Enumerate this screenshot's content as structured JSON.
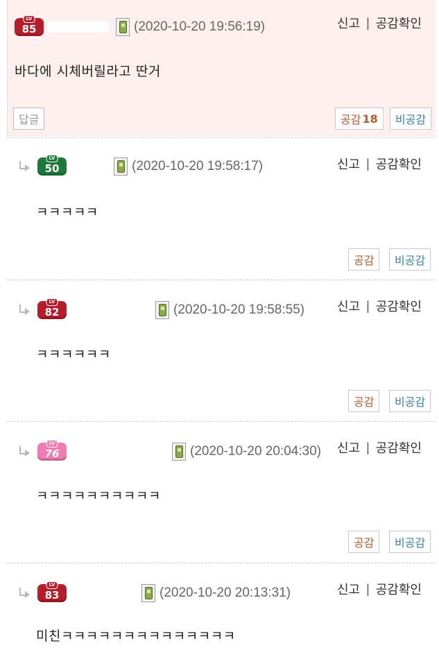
{
  "comments": [
    {
      "level": "85",
      "timestamp": "(2020-10-20 19:56:19)",
      "text": "바다에 시체버릴라고 딴거",
      "report_label": "신고",
      "like_check_label": "공감확인",
      "reply_button": "답글",
      "like_label": "공감",
      "like_count": "18",
      "dislike_label": "비공감"
    },
    {
      "level": "50",
      "timestamp": "(2020-10-20 19:58:17)",
      "text": "ㅋㅋㅋㅋㅋ",
      "report_label": "신고",
      "like_check_label": "공감확인",
      "like_label": "공감",
      "dislike_label": "비공감"
    },
    {
      "level": "82",
      "timestamp": "(2020-10-20 19:58:55)",
      "text": "ㅋㅋㅋㅋㅋㅋ",
      "report_label": "신고",
      "like_check_label": "공감확인",
      "like_label": "공감",
      "dislike_label": "비공감"
    },
    {
      "level": "76",
      "timestamp": "(2020-10-20 20:04:30)",
      "text": "ㅋㅋㅋㅋㅋㅋㅋㅋㅋㅋ",
      "report_label": "신고",
      "like_check_label": "공감확인",
      "like_label": "공감",
      "dislike_label": "비공감"
    },
    {
      "level": "83",
      "timestamp": "(2020-10-20 20:13:31)",
      "text": "미친ㅋㅋㅋㅋㅋㅋㅋㅋㅋㅋㅋㅋㅋㅋ",
      "report_label": "신고",
      "like_check_label": "공감확인"
    }
  ],
  "separator": "|",
  "icons": {
    "reply_arrow": "reply-arrow-icon",
    "mobile": "mobile-phone-icon"
  },
  "colors": {
    "top_comment_bg": "#fff0f0",
    "level_red": "#b71c2a",
    "level_green": "#1b7a3a",
    "level_pink": "#f07bb0",
    "like_text": "#b55a2c",
    "dislike_text": "#3a7fa8"
  }
}
